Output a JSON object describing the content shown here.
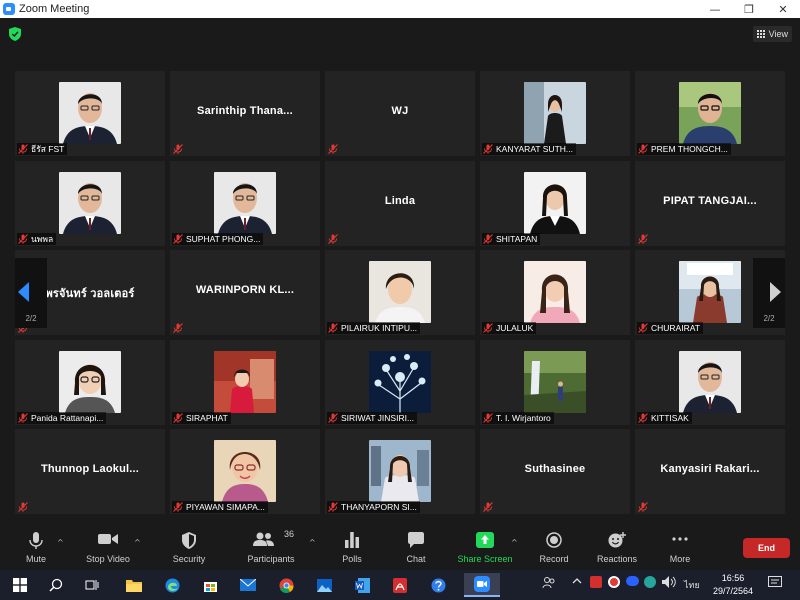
{
  "window": {
    "title": "Zoom Meeting",
    "minimize": "—",
    "maximize": "❐",
    "close": "✕"
  },
  "topbar": {
    "view_label": "View"
  },
  "gallery": {
    "page_indicator_left": "2/2",
    "page_indicator_right": "2/2",
    "tiles": [
      {
        "name": "ธีรัส FST",
        "display": "",
        "photo": "man-suit-glasses"
      },
      {
        "name": "",
        "display": "Sarinthip  Thana...",
        "photo": ""
      },
      {
        "name": "",
        "display": "WJ",
        "photo": ""
      },
      {
        "name": "KANYARAT SUTH...",
        "display": "",
        "photo": "woman-standing"
      },
      {
        "name": "PREM THONGCH...",
        "display": "",
        "photo": "man-outdoors-glasses"
      },
      {
        "name": "นพพล",
        "display": "",
        "photo": "man-suit-glasses"
      },
      {
        "name": "SUPHAT PHONG...",
        "display": "",
        "photo": "man-suit-glasses"
      },
      {
        "name": "",
        "display": "Linda",
        "photo": ""
      },
      {
        "name": "SHITAPAN",
        "display": "",
        "photo": "woman-suit"
      },
      {
        "name": "",
        "display": "PIPAT TANGJAI...",
        "photo": ""
      },
      {
        "name": "",
        "display": "พรจันทร์ วอลเตอร์",
        "photo": ""
      },
      {
        "name": "",
        "display": "WARINPORN  KL...",
        "photo": ""
      },
      {
        "name": "PILAIRUK INTIPU...",
        "display": "",
        "photo": "woman-short-hair"
      },
      {
        "name": "JULALUK",
        "display": "",
        "photo": "woman-pink"
      },
      {
        "name": "CHURAIRAT",
        "display": "",
        "photo": "woman-outdoors"
      },
      {
        "name": "Panida Rattanapi...",
        "display": "",
        "photo": "woman-glasses"
      },
      {
        "name": "SIRAPHAT",
        "display": "",
        "photo": "child-red"
      },
      {
        "name": "SIRIWAT JINSIRI...",
        "display": "",
        "photo": "flower-graphic"
      },
      {
        "name": "T. I. Wirjantoro",
        "display": "",
        "photo": "waterfall"
      },
      {
        "name": "KITTISAK",
        "display": "",
        "photo": "man-suit-glasses"
      },
      {
        "name": "",
        "display": "Thunnop  Laokul...",
        "photo": ""
      },
      {
        "name": "PIYAWAN SIMAPA...",
        "display": "",
        "photo": "painted-portrait"
      },
      {
        "name": "THANYAPORN SI...",
        "display": "",
        "photo": "woman-city"
      },
      {
        "name": "",
        "display": "Suthasinee",
        "photo": ""
      },
      {
        "name": "",
        "display": "Kanyasiri  Rakari...",
        "photo": ""
      }
    ]
  },
  "toolbar": {
    "mute": "Mute",
    "stop_video": "Stop Video",
    "security": "Security",
    "participants": "Participants",
    "participant_count": "36",
    "polls": "Polls",
    "chat": "Chat",
    "share_screen": "Share Screen",
    "record": "Record",
    "reactions": "Reactions",
    "more": "More",
    "end": "End",
    "accent_green": "#23d959",
    "end_red": "#c62828"
  },
  "taskbar": {
    "language": "ไทย",
    "time": "16:56",
    "date": "29/7/2564",
    "apps": [
      "windows-start-icon",
      "search-icon",
      "task-view-icon",
      "file-explorer-icon",
      "edge-icon",
      "store-icon",
      "mail-icon",
      "chrome-icon",
      "photos-icon",
      "word-icon",
      "acrobat-icon",
      "help-icon",
      "zoom-icon"
    ]
  }
}
